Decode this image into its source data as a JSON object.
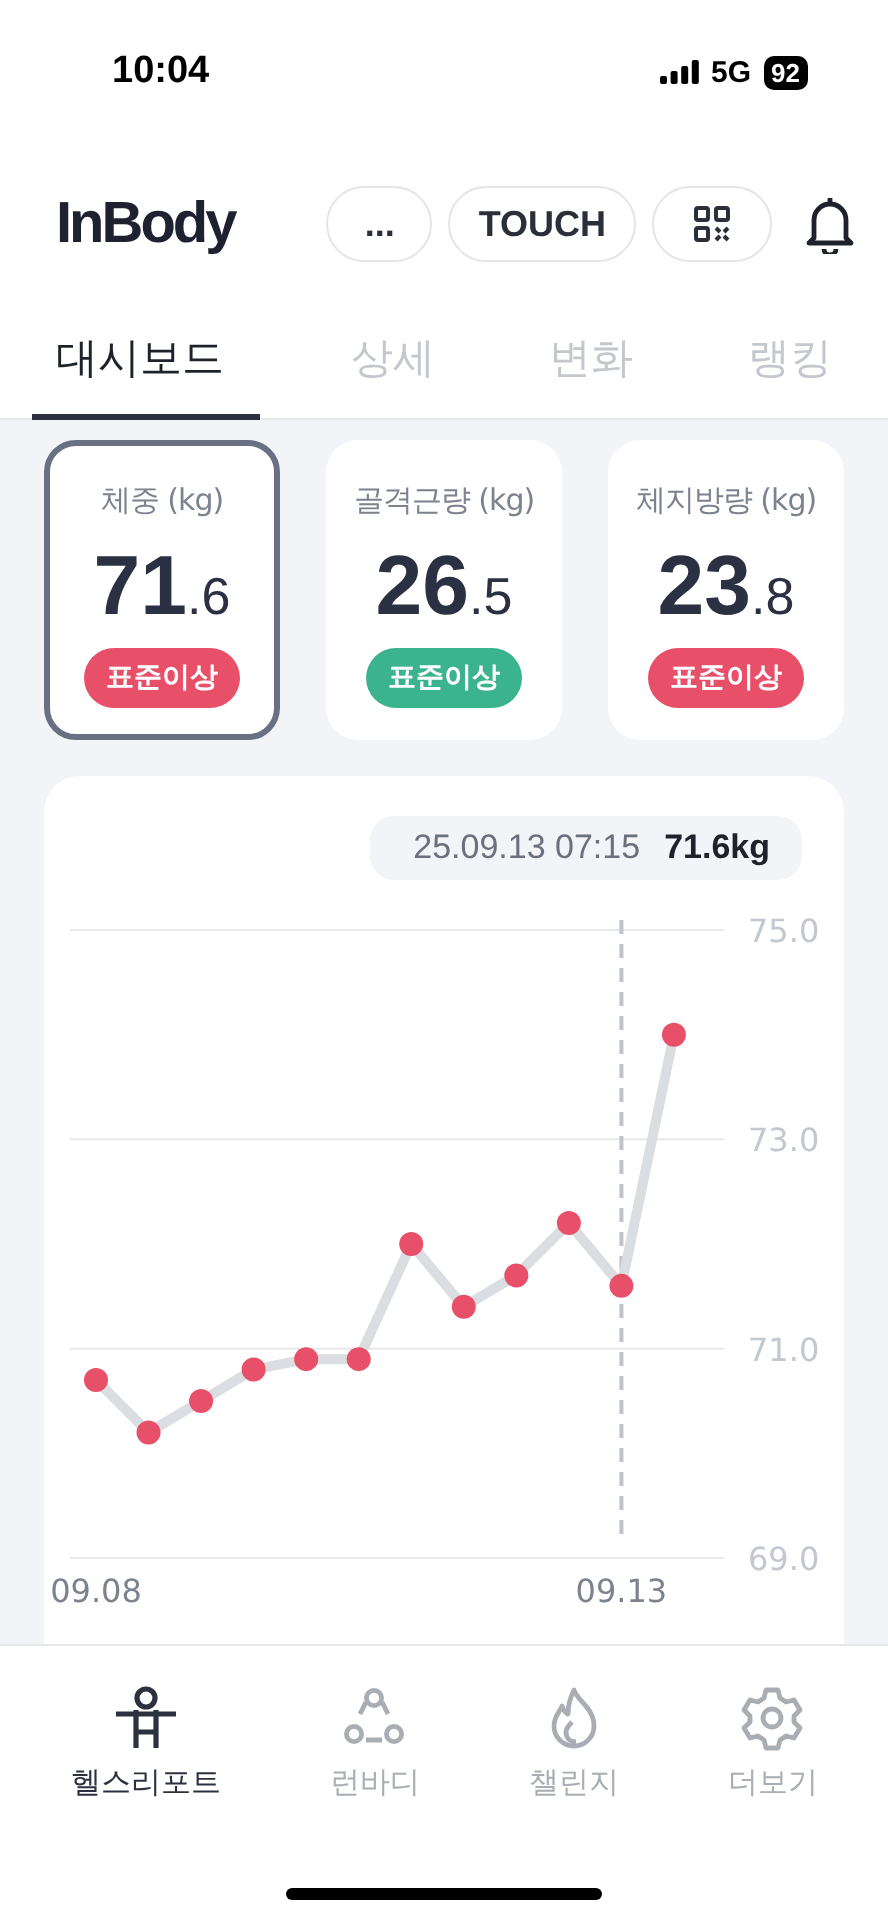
{
  "status_bar": {
    "time": "10:04",
    "network": "5G",
    "battery": "92"
  },
  "header": {
    "logo": "InBody",
    "buttons": [
      {
        "kind": "more",
        "label": "..."
      },
      {
        "kind": "text",
        "label": "TOUCH"
      },
      {
        "kind": "qr"
      }
    ]
  },
  "tabs": [
    {
      "label": "대시보드",
      "selected": true
    },
    {
      "label": "상세",
      "selected": false
    },
    {
      "label": "변화",
      "selected": false
    },
    {
      "label": "랭킹",
      "selected": false
    }
  ],
  "metrics": [
    {
      "label": "체중 (kg)",
      "value_main": "71",
      "value_fraction": ".6",
      "badge": "표준이상",
      "color": "#e8506a",
      "selected": true
    },
    {
      "label": "골격근량 (kg)",
      "value_main": "26",
      "value_fraction": ".5",
      "badge": "표준이상",
      "color": "#3bb38c",
      "selected": false
    },
    {
      "label": "체지방량 (kg)",
      "value_main": "23",
      "value_fraction": ".8",
      "badge": "표준이상",
      "color": "#e8506a",
      "selected": false
    }
  ],
  "chart": {
    "tooltip": {
      "datetime": "25.09.13 07:15",
      "value": "71.6kg"
    },
    "chart_data": {
      "type": "line",
      "categories": [
        "09.08",
        null,
        null,
        null,
        null,
        null,
        null,
        null,
        null,
        null,
        "09.13",
        null
      ],
      "series": [
        {
          "color": "#e8506a",
          "marker": "circle",
          "values": [
            70.7,
            70.2,
            70.5,
            70.8,
            70.9,
            70.9,
            72.0,
            71.4,
            71.7,
            72.2,
            71.6,
            74.0
          ]
        }
      ],
      "ylim": [
        69,
        75
      ],
      "yticks": [
        {
          "value": 75,
          "label": "75.0"
        },
        {
          "value": 73,
          "label": "73.0"
        },
        {
          "value": 71,
          "label": "71.0"
        },
        {
          "value": 69,
          "label": "69.0"
        }
      ],
      "ref_lines": [
        {
          "axis": "x",
          "value": "09.13"
        }
      ]
    }
  },
  "bottom_nav": [
    {
      "kind": "person",
      "label": "헬스리포트",
      "selected": true
    },
    {
      "kind": "nodes",
      "label": "런바디",
      "selected": false
    },
    {
      "kind": "flame",
      "label": "챌린지",
      "selected": false
    },
    {
      "kind": "gear",
      "label": "더보기",
      "selected": false
    }
  ]
}
